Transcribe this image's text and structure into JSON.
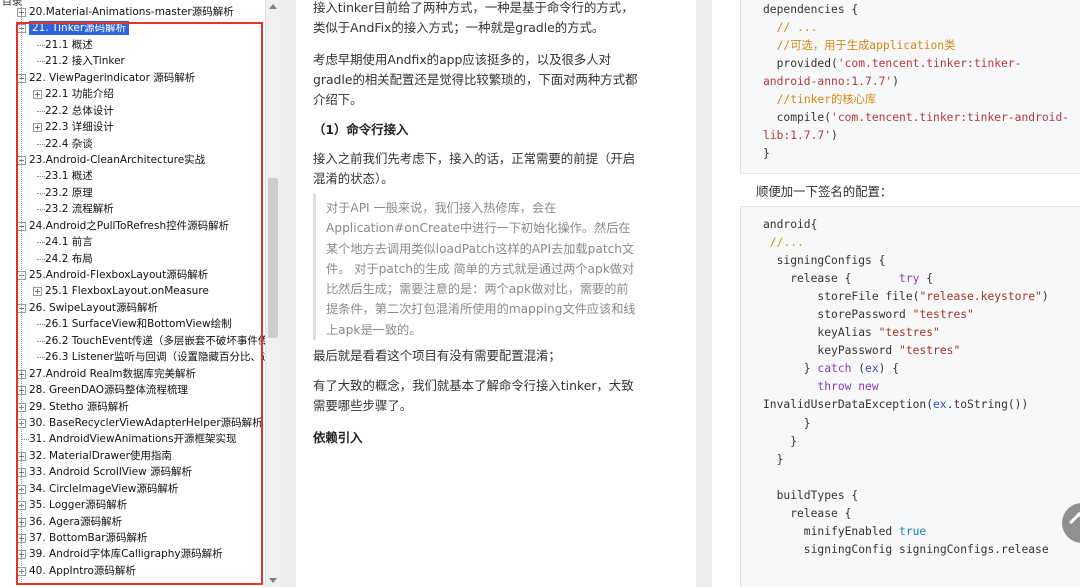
{
  "toc": {
    "header": "目录",
    "items": [
      {
        "text": "20.Material-Animations-master源码解析",
        "level": 0,
        "exp": "+"
      },
      {
        "text": "21. Tinker源码解析",
        "level": 0,
        "exp": "-",
        "selected": true
      },
      {
        "text": "21.1 概述",
        "level": 1
      },
      {
        "text": "21.2 接入Tinker",
        "level": 1
      },
      {
        "text": "22. ViewPagerindicator 源码解析",
        "level": 0,
        "exp": "-"
      },
      {
        "text": "22.1 功能介绍",
        "level": 1,
        "exp": "+"
      },
      {
        "text": "22.2 总体设计",
        "level": 1
      },
      {
        "text": "22.3 详细设计",
        "level": 1,
        "exp": "+"
      },
      {
        "text": "22.4 杂谈",
        "level": 1
      },
      {
        "text": "23.Android-CleanArchitecture实战",
        "level": 0,
        "exp": "-"
      },
      {
        "text": "23.1 概述",
        "level": 1
      },
      {
        "text": "23.2 原理",
        "level": 1
      },
      {
        "text": "23.2 流程解析",
        "level": 1
      },
      {
        "text": "24.Android之PullToRefresh控件源码解析",
        "level": 0,
        "exp": "-"
      },
      {
        "text": "24.1 前言",
        "level": 1
      },
      {
        "text": "24.2 布局",
        "level": 1
      },
      {
        "text": "25.Android-FlexboxLayout源码解析",
        "level": 0,
        "exp": "-"
      },
      {
        "text": "25.1 FlexboxLayout.onMeasure",
        "level": 1,
        "exp": "+"
      },
      {
        "text": "26. SwipeLayout源码解析",
        "level": 0,
        "exp": "-"
      },
      {
        "text": "26.1 SurfaceView和BottomView绘制",
        "level": 1
      },
      {
        "text": "26.2 TouchEvent传递（多层嵌套不破坏事件传递",
        "level": 1
      },
      {
        "text": "26.3 Listener监听与回调（设置隐藏百分比、过渡",
        "level": 1
      },
      {
        "text": "27.Android Realm数据库完美解析",
        "level": 0,
        "exp": "+"
      },
      {
        "text": "28. GreenDAO源码整体流程梳理",
        "level": 0,
        "exp": "+"
      },
      {
        "text": "29. Stetho 源码解析",
        "level": 0,
        "exp": "+"
      },
      {
        "text": "30. BaseRecyclerViewAdapterHelper源码解析",
        "level": 0,
        "exp": "+"
      },
      {
        "text": "31. AndroidViewAnimations开源框架实现",
        "level": 0
      },
      {
        "text": "32. MaterialDrawer使用指南",
        "level": 0,
        "exp": "+"
      },
      {
        "text": "33. Android ScrollView 源码解析",
        "level": 0,
        "exp": "+"
      },
      {
        "text": "34. CircleImageView源码解析",
        "level": 0,
        "exp": "+"
      },
      {
        "text": "35. Logger源码解析",
        "level": 0,
        "exp": "+"
      },
      {
        "text": "36. Agera源码解析",
        "level": 0,
        "exp": "+"
      },
      {
        "text": "37. BottomBar源码解析",
        "level": 0,
        "exp": "+"
      },
      {
        "text": "39. Android字体库Calligraphy源码解析",
        "level": 0,
        "exp": "+"
      },
      {
        "text": "40. AppIntro源码解析",
        "level": 0,
        "exp": "+"
      }
    ]
  },
  "article": {
    "p1": "接入tinker目前给了两种方式，一种是基于命令行的方式，类似于AndFix的接入方式；一种就是gradle的方式。",
    "p2": "考虑早期使用Andfix的app应该挺多的，以及很多人对gradle的相关配置还是觉得比较繁琐的，下面对两种方式都介绍下。",
    "h1": "（1）命令行接入",
    "p3": "接入之前我们先考虑下，接入的话，正常需要的前提（开启混淆的状态）。",
    "quote": "对于API 一般来说，我们接入热修库，会在Application#onCreate中进行一下初始化操作。然后在某个地方去调用类似loadPatch这样的API去加载patch文件。 对于patch的生成 简单的方式就是通过两个apk做对比然后生成；需要注意的是：两个apk做对比，需要的前提条件，第二次打包混淆所使用的mapping文件应该和线上apk是一致的。",
    "p4": "最后就是看看这个项目有没有需要配置混淆；",
    "p5": "有了大致的概念，我们就基本了解命令行接入tinker，大致需要哪些步骤了。",
    "h2": "依赖引入"
  },
  "code": {
    "block1": [
      [
        [
          "t",
          "dependencies {"
        ]
      ],
      [
        [
          "t",
          "  "
        ],
        [
          "cm",
          "// ..."
        ]
      ],
      [
        [
          "t",
          "  "
        ],
        [
          "cm",
          "//可选，用于生成application类"
        ]
      ],
      [
        [
          "t",
          "  provided("
        ],
        [
          "str",
          "'com.tencent.tinker:tinker-"
        ]
      ],
      [
        [
          "str",
          "android-anno:1.7.7'"
        ],
        [
          "t",
          ")"
        ]
      ],
      [
        [
          "t",
          "  "
        ],
        [
          "cm",
          "//tinker的核心库"
        ]
      ],
      [
        [
          "t",
          "  compile("
        ],
        [
          "str",
          "'com.tencent.tinker:tinker-android-"
        ]
      ],
      [
        [
          "str",
          "lib:1.7.7'"
        ],
        [
          "t",
          ")"
        ]
      ],
      [
        [
          "t",
          "}"
        ]
      ]
    ],
    "sign_text": "顺便加一下签名的配置：",
    "block2": [
      [
        [
          "t",
          "android{"
        ]
      ],
      [
        [
          "cm",
          " //..."
        ]
      ],
      [
        [
          "t",
          "  signingConfigs {"
        ]
      ],
      [
        [
          "t",
          "    release {       "
        ],
        [
          "kw",
          "try"
        ],
        [
          "t",
          " {"
        ]
      ],
      [
        [
          "t",
          "        storeFile file("
        ],
        [
          "str2",
          "\"release.keystore\""
        ],
        [
          "t",
          ")"
        ]
      ],
      [
        [
          "t",
          "        storePassword "
        ],
        [
          "str2",
          "\"testres\""
        ]
      ],
      [
        [
          "t",
          "        keyAlias "
        ],
        [
          "str2",
          "\"testres\""
        ]
      ],
      [
        [
          "t",
          "        keyPassword "
        ],
        [
          "str2",
          "\"testres\""
        ]
      ],
      [
        [
          "t",
          "      } "
        ],
        [
          "kw",
          "catch"
        ],
        [
          "t",
          " ("
        ],
        [
          "fn",
          "ex"
        ],
        [
          "t",
          ") {"
        ]
      ],
      [
        [
          "t",
          "        "
        ],
        [
          "kw",
          "throw new"
        ]
      ],
      [
        [
          "t",
          "InvalidUserDataException("
        ],
        [
          "fn",
          "ex"
        ],
        [
          "t",
          ".toString())"
        ]
      ],
      [
        [
          "t",
          "      }"
        ]
      ],
      [
        [
          "t",
          "    }"
        ]
      ],
      [
        [
          "t",
          "  }"
        ]
      ],
      [
        [
          "t",
          ""
        ]
      ],
      [
        [
          "t",
          "  buildTypes {"
        ]
      ],
      [
        [
          "t",
          "    release {"
        ]
      ],
      [
        [
          "t",
          "      minifyEnabled "
        ],
        [
          "num",
          "true"
        ]
      ],
      [
        [
          "t",
          "      signingConfig signingConfigs.release"
        ]
      ]
    ]
  },
  "colors": {
    "selection": "#2b65d9",
    "highlight_box": "#e5322d",
    "string": "#b33a3a",
    "comment": "#d4880f",
    "keyword": "#8b3cad"
  }
}
